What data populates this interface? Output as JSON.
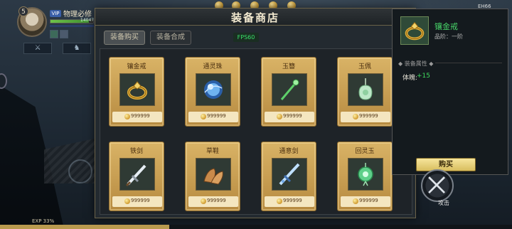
{
  "player": {
    "level": "5",
    "vip": "VIP",
    "name": "物理必修",
    "hp_text": "14047",
    "hp_fraction": 0.9
  },
  "hud": {
    "top_right_text": "EH66",
    "exp_text": "EXP 33%",
    "exp_fraction": 0.33,
    "attack_label": "攻击"
  },
  "shop": {
    "title": "装备商店",
    "tabs": [
      {
        "label": "装备购买",
        "active": true
      },
      {
        "label": "装备合成",
        "active": false
      }
    ],
    "fps": "FPS60",
    "items": [
      {
        "name": "镶金戒",
        "price": "999999",
        "icon": "gold-ring-icon"
      },
      {
        "name": "通灵珠",
        "price": "999999",
        "icon": "spirit-orb-icon"
      },
      {
        "name": "玉簪",
        "price": "999999",
        "icon": "jade-hairpin-icon"
      },
      {
        "name": "玉佩",
        "price": "999999",
        "icon": "jade-pendant-icon"
      },
      {
        "name": "铁剑",
        "price": "999999",
        "icon": "iron-sword-icon"
      },
      {
        "name": "草鞋",
        "price": "999999",
        "icon": "straw-sandals-icon"
      },
      {
        "name": "通意剑",
        "price": "999999",
        "icon": "spirit-sword-icon"
      },
      {
        "name": "回灵玉",
        "price": "999999",
        "icon": "restoring-jade-icon"
      }
    ]
  },
  "detail": {
    "name": "镶金戒",
    "grade": "品阶：一阶",
    "attr_header": "◆ 装备属性 ◆",
    "stat_label": "体魄:",
    "stat_value": "+15",
    "buy_label": "购买"
  },
  "colors": {
    "card_gold": "#caa155",
    "detail_green": "#47d268",
    "stat_green": "#3fdc5e",
    "fps_green": "#38e06a"
  }
}
